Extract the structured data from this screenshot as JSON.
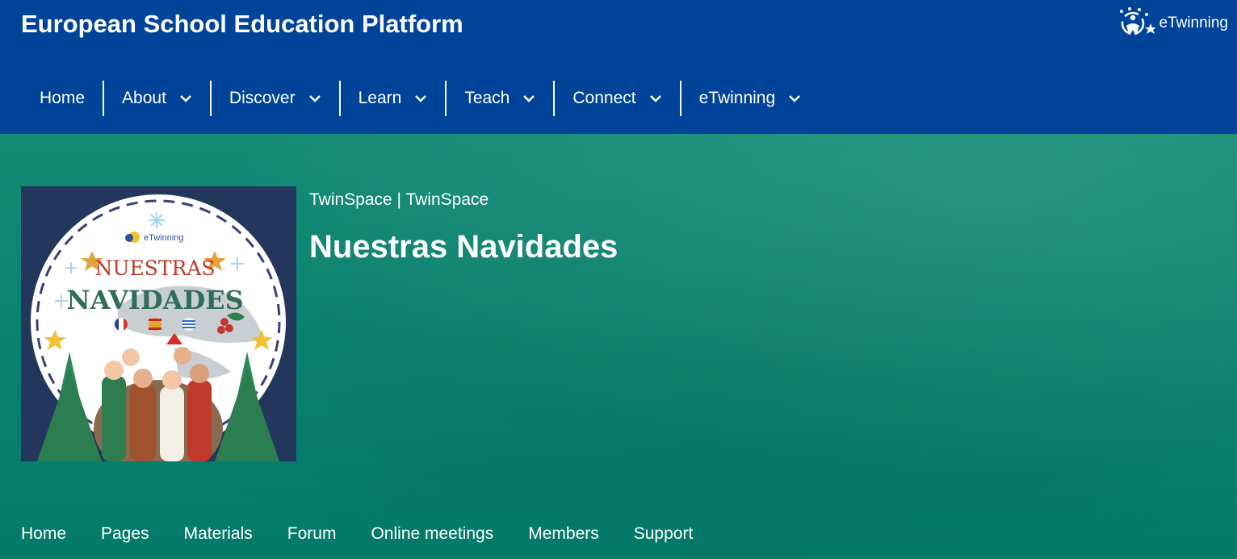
{
  "header": {
    "site_title": "European School Education Platform",
    "brand_label": "eTwinning"
  },
  "main_nav": [
    {
      "label": "Home",
      "has_dropdown": false
    },
    {
      "label": "About",
      "has_dropdown": true
    },
    {
      "label": "Discover",
      "has_dropdown": true
    },
    {
      "label": "Learn",
      "has_dropdown": true
    },
    {
      "label": "Teach",
      "has_dropdown": true
    },
    {
      "label": "Connect",
      "has_dropdown": true
    },
    {
      "label": "eTwinning",
      "has_dropdown": true
    }
  ],
  "hero": {
    "breadcrumb": "TwinSpace | TwinSpace",
    "title": "Nuestras Navidades",
    "image": {
      "logo_text": "eTwinning",
      "line1": "NUESTRAS",
      "line2": "NAVIDADES"
    }
  },
  "sub_nav": [
    "Home",
    "Pages",
    "Materials",
    "Forum",
    "Online meetings",
    "Members",
    "Support"
  ],
  "colors": {
    "header_bg": "#00449a",
    "hero_bg": "#047a6a",
    "text": "#ffffff"
  }
}
